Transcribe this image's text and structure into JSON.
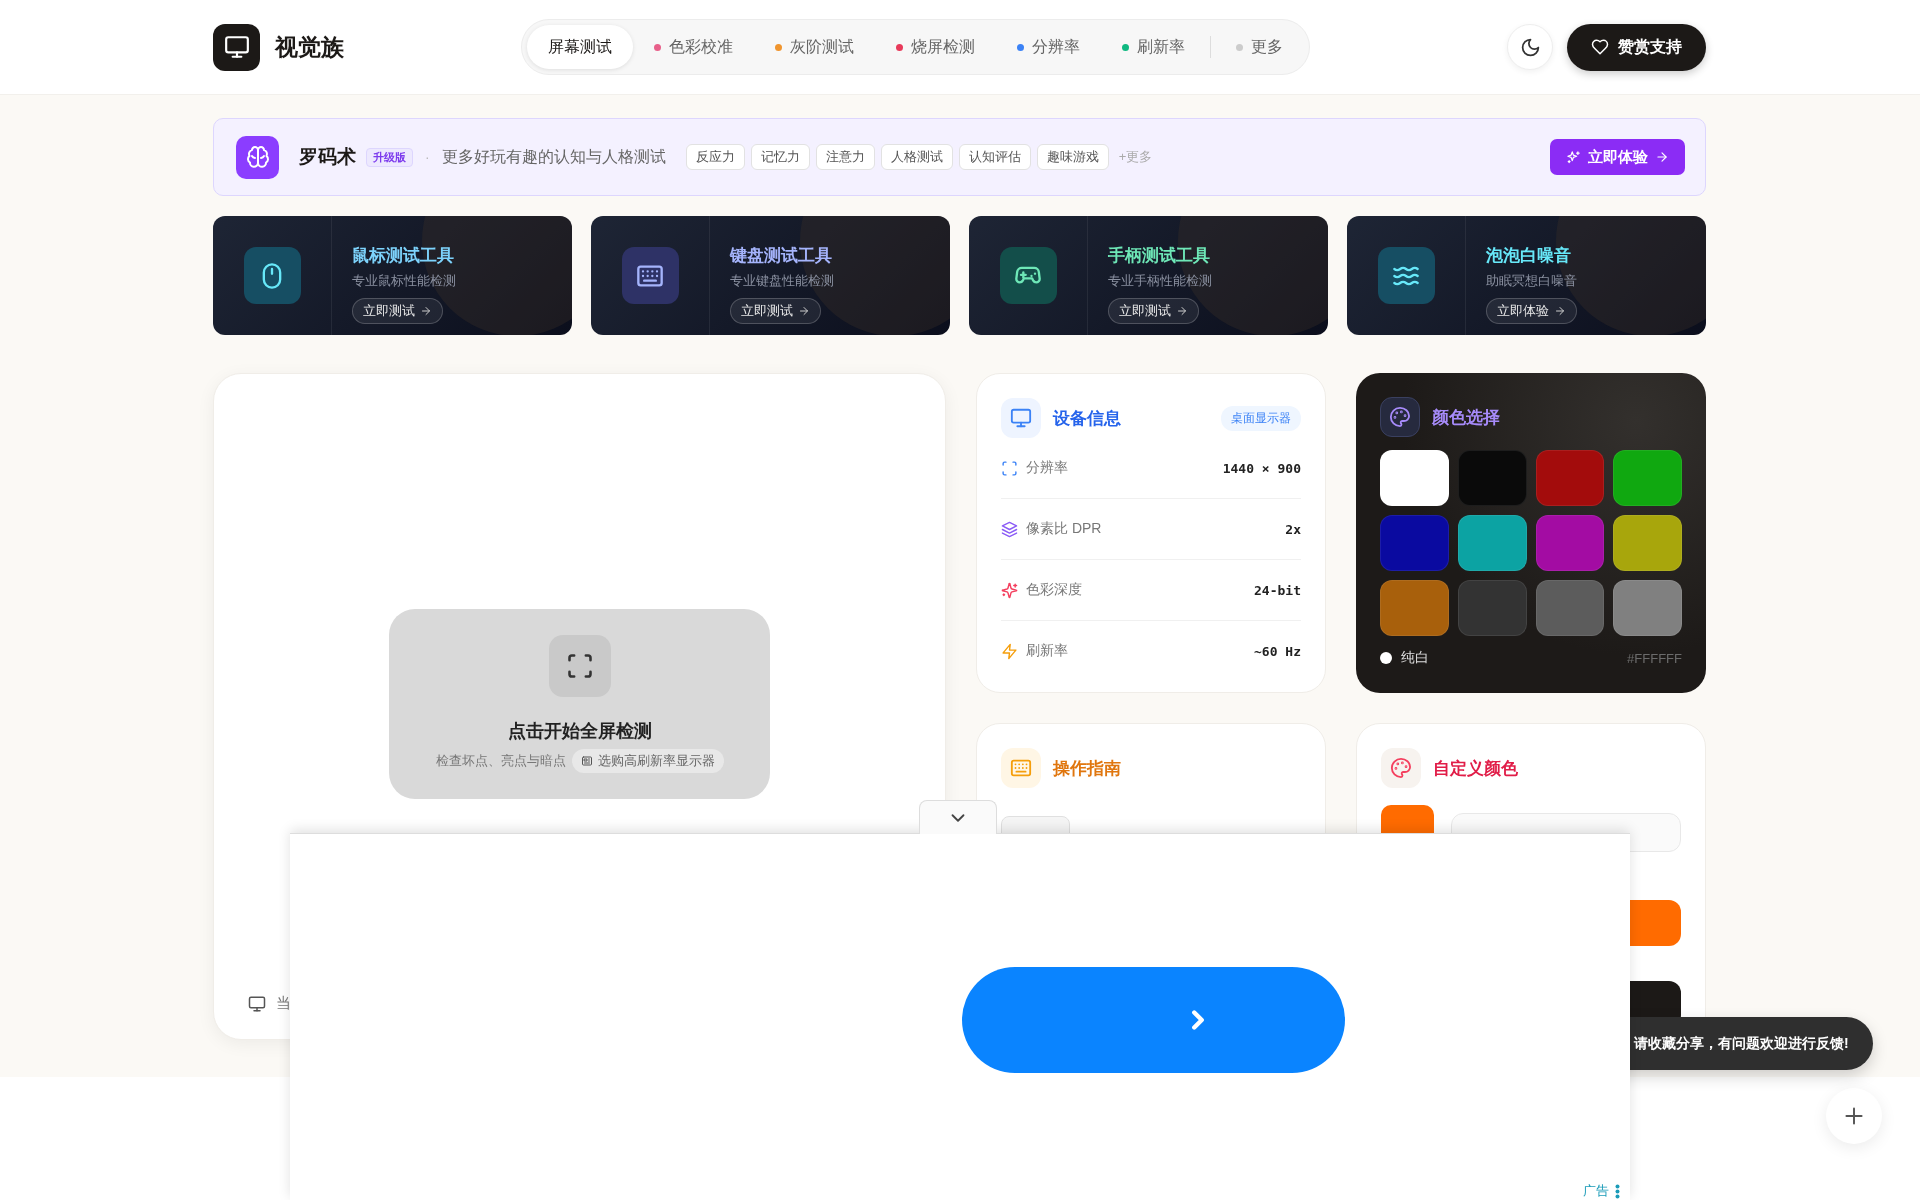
{
  "brand": {
    "name": "视觉族"
  },
  "nav": {
    "items": [
      {
        "label": "屏幕测试",
        "selected": true
      },
      {
        "label": "色彩校准",
        "selected": false,
        "color": "#e8608a"
      },
      {
        "label": "灰阶测试",
        "selected": false,
        "color": "#f0952e"
      },
      {
        "label": "烧屏检测",
        "selected": false,
        "color": "#e83a5a"
      },
      {
        "label": "分辨率",
        "selected": false,
        "color": "#3b82f6"
      },
      {
        "label": "刷新率",
        "selected": false,
        "color": "#10b981"
      },
      {
        "label": "更多",
        "selected": false,
        "color": "#cccccc"
      }
    ]
  },
  "support_button": "赞赏支持",
  "promo": {
    "name": "罗码术",
    "badge": "升级版",
    "separator": "·",
    "text": "更多好玩有趣的认知与人格测试",
    "tags": [
      "反应力",
      "记忆力",
      "注意力",
      "人格测试",
      "认知评估",
      "趣味游戏"
    ],
    "more": "+更多",
    "button": "立即体验"
  },
  "tool_cards": [
    {
      "kind": "mouse",
      "title": "鼠标测试工具",
      "subtitle": "专业鼠标性能检测",
      "button": "立即测试",
      "color": "#7dd3fc"
    },
    {
      "kind": "keyboard",
      "title": "键盘测试工具",
      "subtitle": "专业键盘性能检测",
      "button": "立即测试",
      "color": "#a5b4fc"
    },
    {
      "kind": "gamepad",
      "title": "手柄测试工具",
      "subtitle": "专业手柄性能检测",
      "button": "立即测试",
      "color": "#6ee7b7"
    },
    {
      "kind": "waves",
      "title": "泡泡白噪音",
      "subtitle": "助眠冥想白噪音",
      "button": "立即体验",
      "color": "#67e8f9"
    }
  ],
  "screen_test": {
    "title": "点击开始全屏检测",
    "subtitle": "检查坏点、亮点与暗点",
    "chip": "选购高刷新率显示器",
    "footer": "当"
  },
  "device_info": {
    "title": "设备信息",
    "badge": "桌面显示器",
    "rows": [
      {
        "kind": "resolution",
        "label": "分辨率",
        "value": "1440 × 900"
      },
      {
        "kind": "dpr",
        "label": "像素比 DPR",
        "value": "2x"
      },
      {
        "kind": "depth",
        "label": "色彩深度",
        "value": "24-bit"
      },
      {
        "kind": "refresh",
        "label": "刷新率",
        "value": "~60 Hz"
      }
    ]
  },
  "color_picker": {
    "title": "颜色选择",
    "swatches": [
      {
        "color": "#ffffff"
      },
      {
        "color": "#0a0a0a"
      },
      {
        "color": "#a30c0c"
      },
      {
        "color": "#10a810"
      },
      {
        "color": "#0a0aa0"
      },
      {
        "color": "#0ca3a3"
      },
      {
        "color": "#a30ca3"
      },
      {
        "color": "#a8a60c"
      },
      {
        "color": "#a8600c"
      },
      {
        "color": "#333333"
      },
      {
        "color": "#5c5c5c"
      },
      {
        "color": "#808080"
      }
    ],
    "current_name": "纯白",
    "current_hex": "#FFFFFF"
  },
  "guide": {
    "title": "操作指南"
  },
  "custom_color": {
    "title": "自定义颜色",
    "color": "#ff6b00"
  },
  "ad": {
    "label": "广告"
  },
  "toast": "请收藏分享，有问题欢迎进行反馈!"
}
